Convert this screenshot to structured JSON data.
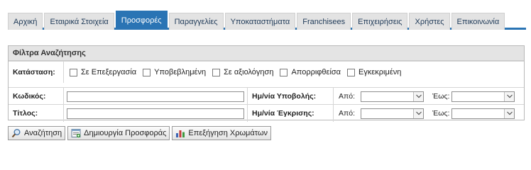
{
  "tabs": [
    {
      "label": "Αρχική",
      "active": false
    },
    {
      "label": "Εταιρικά Στοιχεία",
      "active": false
    },
    {
      "label": "Προσφορές",
      "active": true
    },
    {
      "label": "Παραγγελίες",
      "active": false
    },
    {
      "label": "Υποκαταστήματα",
      "active": false
    },
    {
      "label": "Franchisees",
      "active": false
    },
    {
      "label": "Επιχειρήσεις",
      "active": false
    },
    {
      "label": "Χρήστες",
      "active": false
    },
    {
      "label": "Επικοινωνία",
      "active": false
    }
  ],
  "filter": {
    "title": "Φίλτρα Αναζήτησης",
    "status_label": "Κατάσταση:",
    "statuses": [
      "Σε Επεξεργασία",
      "Υποβεβλημένη",
      "Σε αξιολόγηση",
      "Απορριφθείσα",
      "Εγκεκριμένη"
    ],
    "code_label": "Κωδικός:",
    "code_value": "",
    "title_label": "Τίτλος:",
    "title_value": "",
    "submit_date_label": "Ημ/νία Υποβολής:",
    "approve_date_label": "Ημ/νία Έγκρισης:",
    "from_label": "Από:",
    "to_label": "Έως:"
  },
  "buttons": {
    "search": "Αναζήτηση",
    "create": "Δημιουργία Προσφοράς",
    "colors": "Επεξήγηση Χρωμάτων"
  },
  "colors": {
    "accent": "#2a74b4"
  }
}
